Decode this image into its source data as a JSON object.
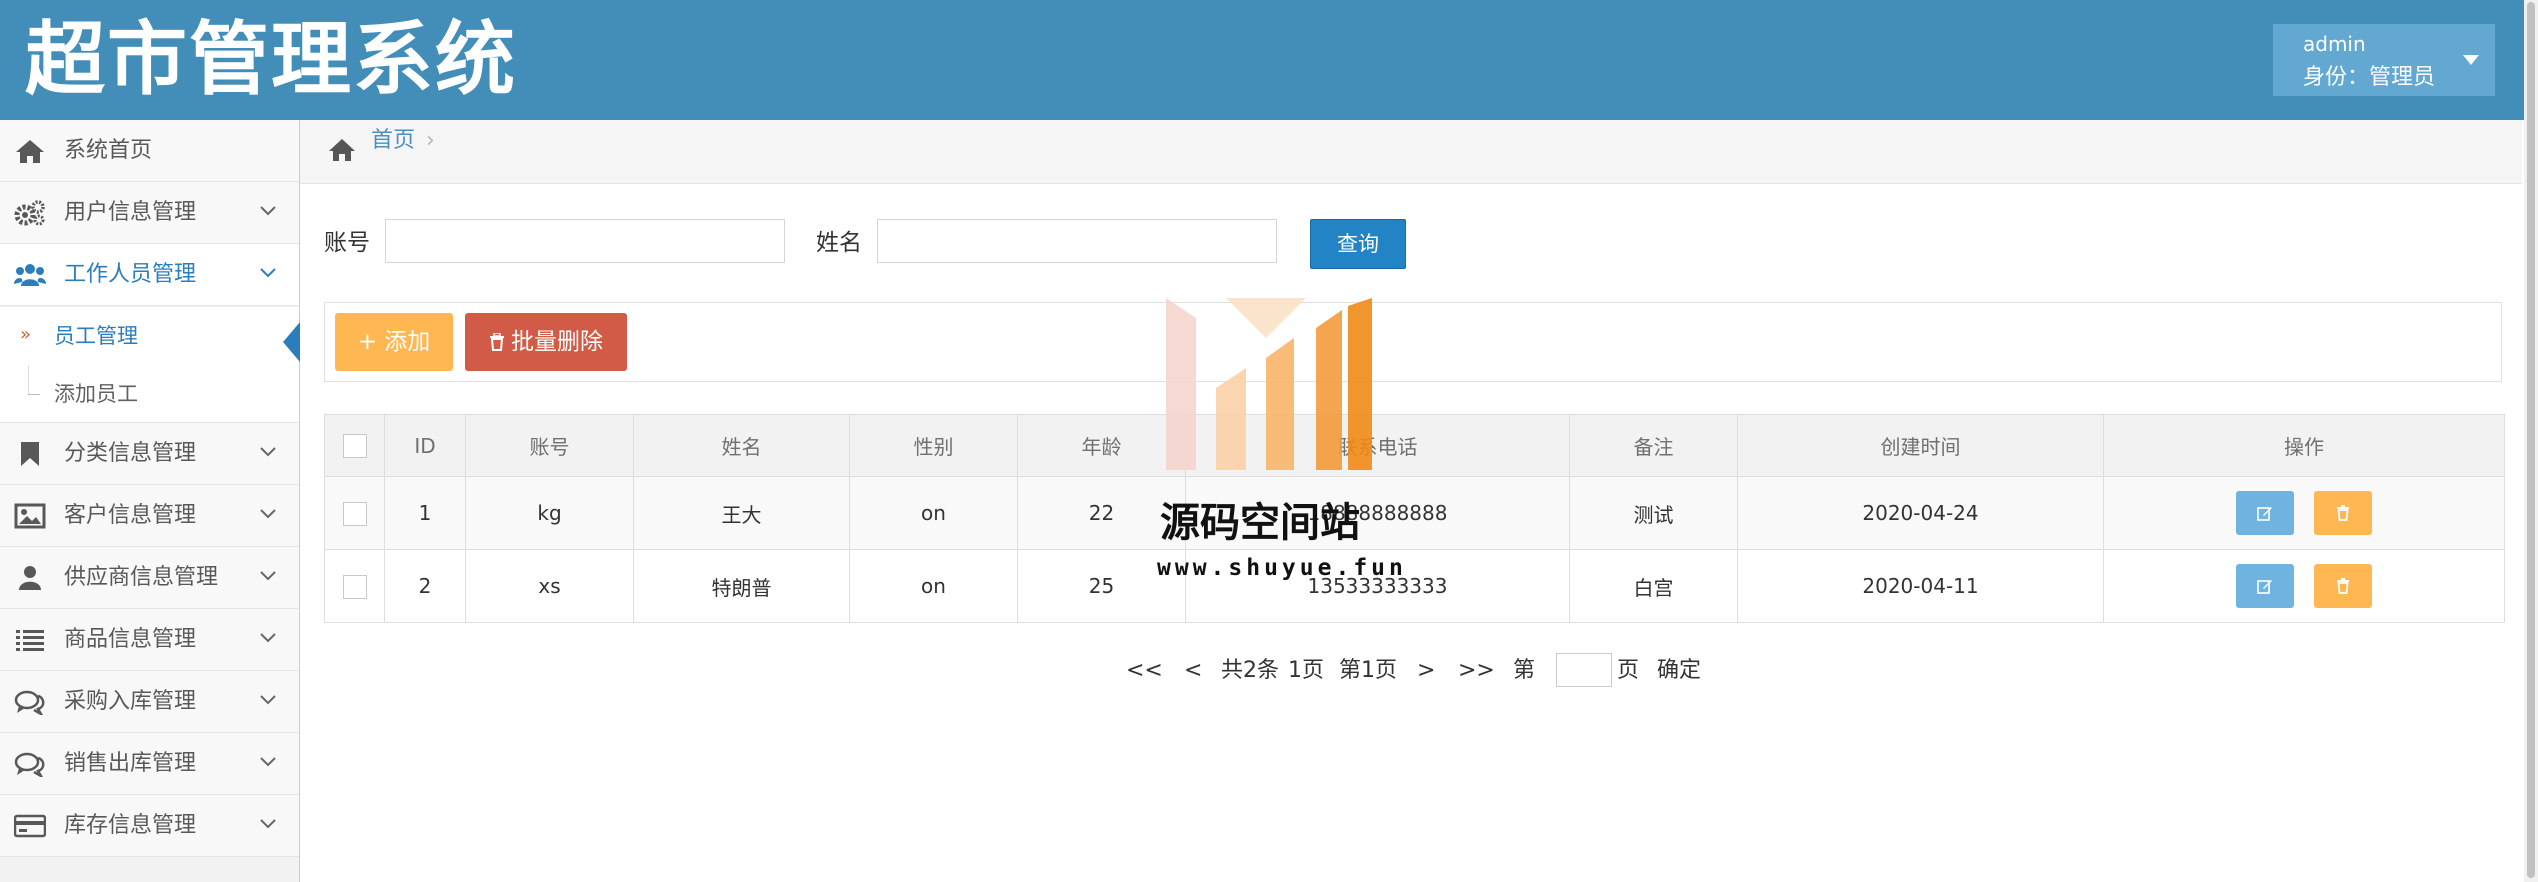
{
  "header": {
    "title": "超市管理系统",
    "user_name": "admin",
    "user_role": "身份：管理员",
    "caret_icon": "caret-down-icon"
  },
  "sidebar": {
    "items": [
      {
        "label": "系统首页",
        "icon": "home-icon"
      },
      {
        "label": "用户信息管理",
        "icon": "cogs-icon"
      },
      {
        "label": "工作人员管理",
        "icon": "users-icon"
      },
      {
        "label": "分类信息管理",
        "icon": "bookmark-icon"
      },
      {
        "label": "客户信息管理",
        "icon": "picture-icon"
      },
      {
        "label": "供应商信息管理",
        "icon": "user-icon"
      },
      {
        "label": "商品信息管理",
        "icon": "list-icon"
      },
      {
        "label": "采购入库管理",
        "icon": "comments-icon"
      },
      {
        "label": "销售出库管理",
        "icon": "comments-icon"
      },
      {
        "label": "库存信息管理",
        "icon": "credit-card-icon"
      }
    ],
    "subitems": [
      {
        "label": "员工管理",
        "active": true
      },
      {
        "label": "添加员工",
        "active": false
      }
    ],
    "active_marker": "»"
  },
  "breadcrumb": {
    "home": "首页",
    "separator": "›"
  },
  "search": {
    "account_label": "账号",
    "account_value": "",
    "name_label": "姓名",
    "name_value": "",
    "query_button": "查询"
  },
  "toolbar": {
    "add_label": "+ 添加",
    "batch_delete_label": "批量删除"
  },
  "table": {
    "headers": [
      "ID",
      "账号",
      "姓名",
      "性别",
      "年龄",
      "联系电话",
      "备注",
      "创建时间",
      "操作"
    ],
    "rows": [
      {
        "id": "1",
        "account": "kg",
        "name": "王大",
        "gender": "on",
        "age": "22",
        "phone": "18888888888",
        "note": "测试",
        "created": "2020-04-24"
      },
      {
        "id": "2",
        "account": "xs",
        "name": "特朗普",
        "gender": "on",
        "age": "25",
        "phone": "13533333333",
        "note": "白宫",
        "created": "2020-04-11"
      }
    ]
  },
  "pager": {
    "first": "<<",
    "prev": "<",
    "total": "共2条",
    "pages": "1页",
    "current": "第1页",
    "next": ">",
    "last": ">>",
    "goto_prefix": "第",
    "goto_value": "",
    "goto_suffix": "页",
    "confirm": "确定"
  },
  "watermark": {
    "title": "源码空间站",
    "url": "www.shuyue.fun"
  },
  "colors": {
    "header_bg": "#438eb9",
    "user_box_bg": "#62a8d1",
    "active_blue": "#2b7dbc",
    "query_button": "#2283c5",
    "add_button": "#ffb752",
    "batch_delete_button": "#d15b47",
    "edit_button": "#6fb3e0",
    "delete_button": "#ffb752"
  }
}
